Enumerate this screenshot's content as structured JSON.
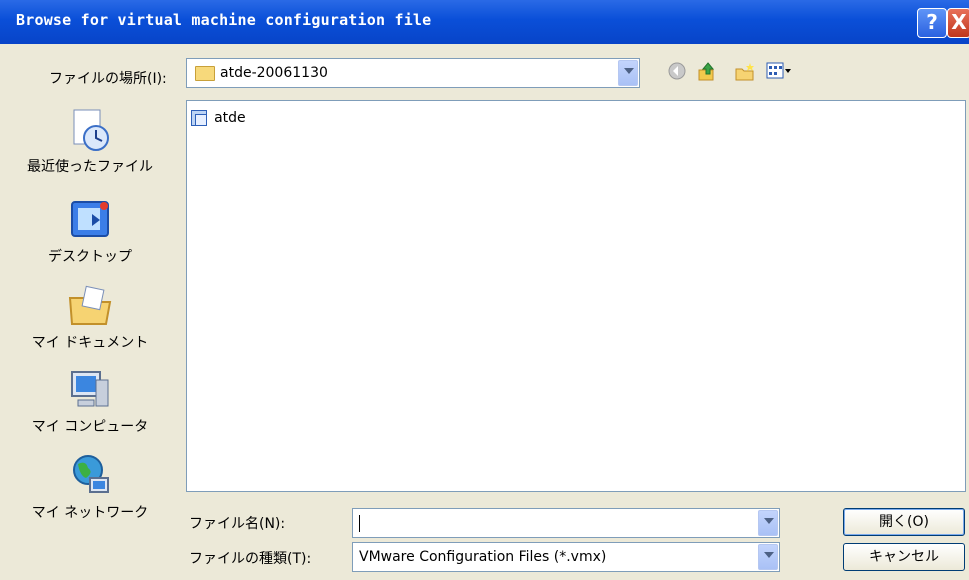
{
  "window": {
    "title": "Browse for virtual machine configuration file",
    "help_glyph": "?",
    "close_glyph": "X"
  },
  "toolbar": {
    "look_in_label": "ファイルの場所(I):",
    "look_in_value": "atde-20061130",
    "icons": [
      "back-icon",
      "up-folder-icon",
      "new-folder-icon",
      "views-menu-icon"
    ]
  },
  "places": [
    {
      "label": "最近使ったファイル",
      "icon": "recent-files-icon"
    },
    {
      "label": "デスクトップ",
      "icon": "desktop-icon"
    },
    {
      "label": "マイ ドキュメント",
      "icon": "my-documents-icon"
    },
    {
      "label": "マイ コンピュータ",
      "icon": "my-computer-icon"
    },
    {
      "label": "マイ ネットワーク",
      "icon": "my-network-icon"
    }
  ],
  "files": [
    {
      "name": "atde",
      "icon": "vm-file-icon"
    }
  ],
  "form": {
    "filename_label": "ファイル名(N):",
    "filename_value": "",
    "filetype_label": "ファイルの種類(T):",
    "filetype_value": "VMware Configuration Files (*.vmx)"
  },
  "buttons": {
    "open": "開く(O)",
    "cancel": "キャンセル"
  },
  "colors": {
    "titlebar": "#0a4fd8",
    "dialog_bg": "#ece9d8",
    "field_border": "#7f9db9"
  }
}
